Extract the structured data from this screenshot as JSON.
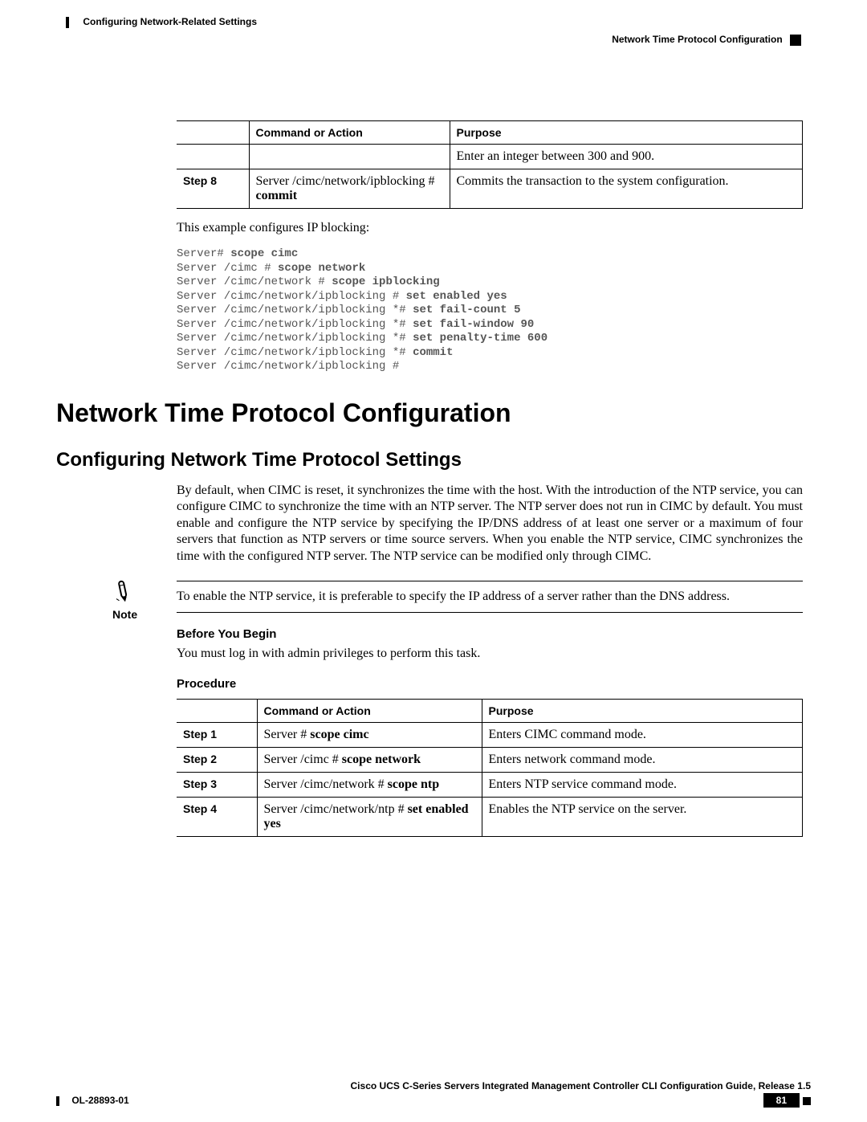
{
  "header": {
    "left": "Configuring Network-Related Settings",
    "right": "Network Time Protocol Configuration"
  },
  "table1": {
    "head": {
      "col2": "Command or Action",
      "col3": "Purpose"
    },
    "row0": {
      "col3": "Enter an integer between 300 and 900."
    },
    "row1": {
      "step": "Step 8",
      "cmd_prefix": "Server /cimc/network/ipblocking # ",
      "cmd_bold": "commit",
      "purpose": "Commits the transaction to the system configuration."
    }
  },
  "example_intro": "This example configures IP blocking:",
  "cli": {
    "l1p": "Server# ",
    "l1b": "scope cimc",
    "l2p": "Server /cimc # ",
    "l2b": "scope network",
    "l3p": "Server /cimc/network # ",
    "l3b": "scope ipblocking",
    "l4p": "Server /cimc/network/ipblocking # ",
    "l4b": "set enabled yes",
    "l5p": "Server /cimc/network/ipblocking *# ",
    "l5b": "set fail-count 5",
    "l6p": "Server /cimc/network/ipblocking *# ",
    "l6b": "set fail-window 90",
    "l7p": "Server /cimc/network/ipblocking *# ",
    "l7b": "set penalty-time 600",
    "l8p": "Server /cimc/network/ipblocking *# ",
    "l8b": "commit",
    "l9p": "Server /cimc/network/ipblocking #"
  },
  "h1": "Network Time Protocol Configuration",
  "h2": "Configuring Network Time Protocol Settings",
  "body_para": "By default, when CIMC is reset, it synchronizes the time with the host. With the introduction of the NTP service, you can configure CIMC to synchronize the time with an NTP server. The NTP server does not run in CIMC by default. You must enable and configure the NTP service by specifying the IP/DNS address of at least one server or a maximum of four servers that function as NTP servers or time source servers. When you enable the NTP service, CIMC synchronizes the time with the configured NTP server. The NTP service can be modified only through CIMC.",
  "note": {
    "label": "Note",
    "text": "To enable the NTP service, it is preferable to specify the IP address of a server rather than the DNS address."
  },
  "before_begin": {
    "title": "Before You Begin",
    "text": "You must log in with admin privileges to perform this task."
  },
  "procedure_title": "Procedure",
  "table2": {
    "head": {
      "col2": "Command or Action",
      "col3": "Purpose"
    },
    "rows": [
      {
        "step": "Step 1",
        "cmd_prefix": "Server # ",
        "cmd_bold": "scope cimc",
        "purpose": "Enters CIMC command mode."
      },
      {
        "step": "Step 2",
        "cmd_prefix": "Server /cimc # ",
        "cmd_bold": "scope network",
        "purpose": "Enters network command mode."
      },
      {
        "step": "Step 3",
        "cmd_prefix": "Server /cimc/network # ",
        "cmd_bold": "scope ntp",
        "purpose": "Enters NTP service command mode."
      },
      {
        "step": "Step 4",
        "cmd_prefix": "Server /cimc/network/ntp # ",
        "cmd_bold": "set enabled yes",
        "purpose": "Enables the NTP service on the server."
      }
    ]
  },
  "footer": {
    "guide": "Cisco UCS C-Series Servers Integrated Management Controller CLI Configuration Guide, Release 1.5",
    "doc": "OL-28893-01",
    "page": "81"
  }
}
